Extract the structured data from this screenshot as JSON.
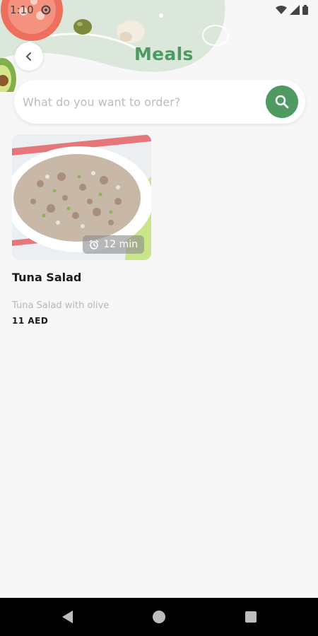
{
  "status_bar": {
    "time": "1:10",
    "icons": [
      "app-notification-icon",
      "wifi-icon",
      "signal-icon",
      "battery-icon"
    ]
  },
  "header": {
    "title": "Meals",
    "back_icon": "chevron-left-icon"
  },
  "search": {
    "placeholder": "What do you want to order?",
    "value": "",
    "icon": "search-icon"
  },
  "meals": [
    {
      "name": "Tuna Salad",
      "description": "Tuna Salad with olive",
      "price": "11 AED",
      "prep_time": "12 min",
      "time_icon": "alarm-clock-icon"
    }
  ],
  "nav": {
    "back": "back-triangle-icon",
    "home": "home-circle-icon",
    "recents": "recents-square-icon"
  },
  "colors": {
    "accent": "#4f9a63",
    "background": "#f7f7f7",
    "header_blob": "#d9e6d9",
    "text_primary": "#1c1c1c",
    "text_muted": "#b7b7b7"
  }
}
